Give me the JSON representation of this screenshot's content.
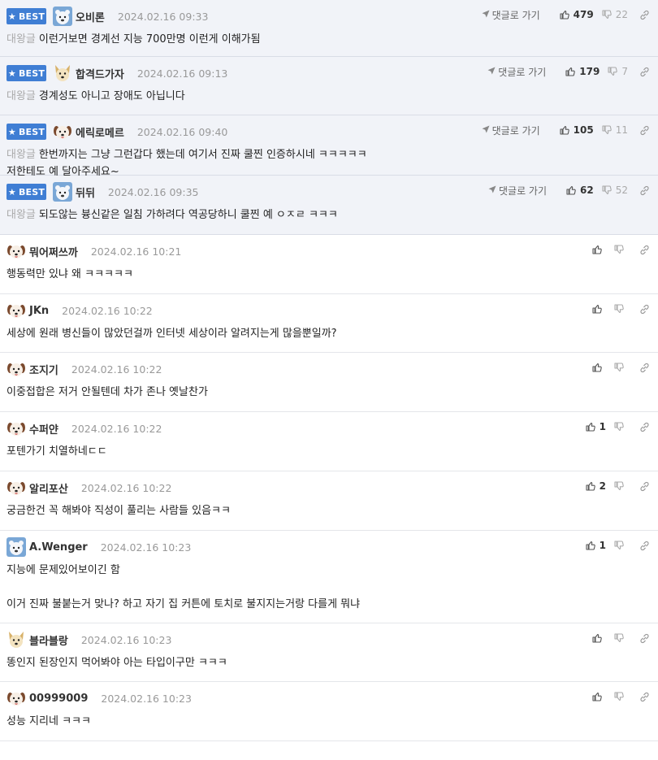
{
  "labels": {
    "best": "BEST",
    "reply_prefix": "대왕글",
    "goto_reply": "댓글로 가기"
  },
  "colors": {
    "best_badge": "#3f7ed4",
    "best_row_bg": "#f1f3f8"
  },
  "comments": [
    {
      "best": true,
      "avatar": "polar-bear-avatar",
      "nick": "오비론",
      "date": "2024.02.16 09:33",
      "up": "479",
      "down": "22",
      "prefix": true,
      "text": "이런거보면 경계선 지능 700만명 이런게 이해가됨"
    },
    {
      "best": true,
      "avatar": "dog-avatar",
      "nick": "합격드가자",
      "date": "2024.02.16 09:13",
      "up": "179",
      "down": "7",
      "prefix": true,
      "text": "경계성도 아니고 장애도 아닙니다"
    },
    {
      "best": true,
      "avatar": "puppy-avatar",
      "nick": "에릭로메르",
      "date": "2024.02.16 09:40",
      "up": "105",
      "down": "11",
      "prefix": true,
      "text": "한번까지는 그냥 그런갑다 했는데 여기서 진짜 쿨찐 인증하시네 ㅋㅋㅋㅋㅋ\n저한테도 예 달아주세요~"
    },
    {
      "best": true,
      "avatar": "polar-bear-avatar",
      "nick": "뒤뒤",
      "date": "2024.02.16 09:35",
      "up": "62",
      "down": "52",
      "prefix": true,
      "text": "되도않는 븅신같은 일침 가하려다 역공당하니 쿨찐 예 ㅇㅈㄹ ㅋㅋㅋ"
    },
    {
      "best": false,
      "avatar": "puppy-avatar",
      "nick": "뭐어쩌쓰까",
      "date": "2024.02.16 10:21",
      "up": "",
      "down": "",
      "prefix": false,
      "text": "행동력만 있냐 왜 ㅋㅋㅋㅋㅋ"
    },
    {
      "best": false,
      "avatar": "puppy-avatar",
      "nick": "JKn",
      "date": "2024.02.16 10:22",
      "up": "",
      "down": "",
      "prefix": false,
      "text": "세상에 원래 병신들이 많았던걸까 인터넷 세상이라 알려지는게 많을뿐일까?"
    },
    {
      "best": false,
      "avatar": "puppy-avatar",
      "nick": "조지기",
      "date": "2024.02.16 10:22",
      "up": "",
      "down": "",
      "prefix": false,
      "text": "이중접합은 저거 안될텐데 차가 존나 옛날찬가"
    },
    {
      "best": false,
      "avatar": "puppy-avatar",
      "nick": "수퍼얀",
      "date": "2024.02.16 10:22",
      "up": "1",
      "down": "",
      "prefix": false,
      "text": "포텐가기 치열하네ㄷㄷ"
    },
    {
      "best": false,
      "avatar": "puppy-avatar",
      "nick": "알리포산",
      "date": "2024.02.16 10:22",
      "up": "2",
      "down": "",
      "prefix": false,
      "text": "궁금한건 꼭 해봐야 직성이 풀리는 사람들 있음ㅋㅋ"
    },
    {
      "best": false,
      "avatar": "polar-bear-avatar",
      "nick": "A.Wenger",
      "date": "2024.02.16 10:23",
      "up": "1",
      "down": "",
      "prefix": false,
      "text": "지능에 문제있어보이긴 함\n\n이거 진짜 불붙는거 맞나? 하고 자기 집 커튼에 토치로 불지지는거랑 다를게 뭐냐"
    },
    {
      "best": false,
      "avatar": "dog-avatar",
      "nick": "블라블랑",
      "date": "2024.02.16 10:23",
      "up": "",
      "down": "",
      "prefix": false,
      "text": "똥인지 된장인지 먹어봐야 아는 타입이구만 ㅋㅋㅋ"
    },
    {
      "best": false,
      "avatar": "puppy-avatar",
      "nick": "00999009",
      "date": "2024.02.16 10:23",
      "up": "",
      "down": "",
      "prefix": false,
      "text": "성능 지리네 ㅋㅋㅋ"
    }
  ]
}
